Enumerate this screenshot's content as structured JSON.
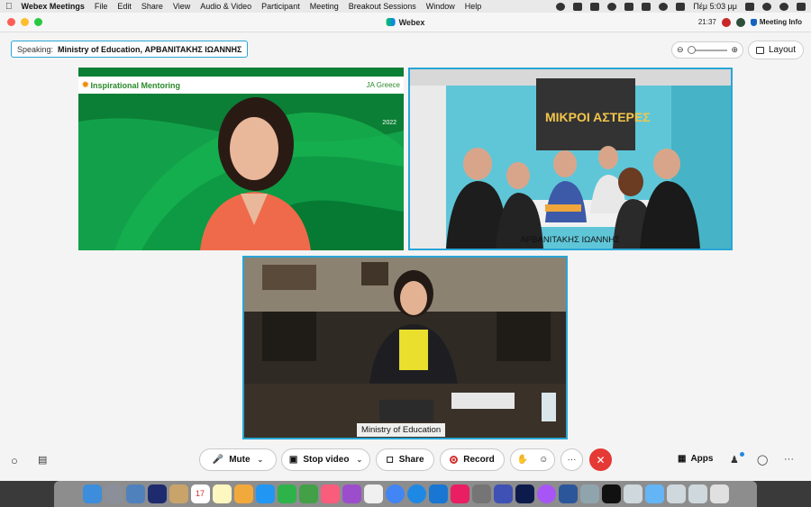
{
  "menubar": {
    "app_name": "Webex Meetings",
    "items": [
      "File",
      "Edit",
      "Share",
      "View",
      "Audio & Video",
      "Participant",
      "Meeting",
      "Breakout Sessions",
      "Window",
      "Help"
    ],
    "clock": "Πέμ 5:03 μμ"
  },
  "window": {
    "title": "Webex",
    "time": "21:37",
    "meeting_info": "Meeting Info"
  },
  "speaking": {
    "prefix": "Speaking:",
    "names": "Ministry of Education,   ΑΡΒΑΝΙΤΑΚΗΣ ΙΩΑΝΝΗΣ"
  },
  "layout_button": "Layout",
  "tiles": {
    "tile1": {
      "banner_left": "Inspirational Mentoring",
      "banner_right": "JA Greece",
      "year": "2022"
    },
    "tile2": {
      "label": "ΑΡΒΑΝΙΤΑΚΗΣ ΙΩΑΝΝΗΣ",
      "wall_text": "ΜΙΚΡΟΙ ΑΣΤΕΡΕΣ"
    },
    "tile3": {
      "label": "Ministry of Education"
    }
  },
  "controls": {
    "mute": "Mute",
    "stop_video": "Stop video",
    "share": "Share",
    "record": "Record",
    "more": "···",
    "apps": "Apps",
    "overflow": "···"
  },
  "colors": {
    "speaker_border": "#29a5d6",
    "leave": "#e53935",
    "record": "#d32f2f"
  },
  "dock": {
    "calendar_day": "17"
  }
}
